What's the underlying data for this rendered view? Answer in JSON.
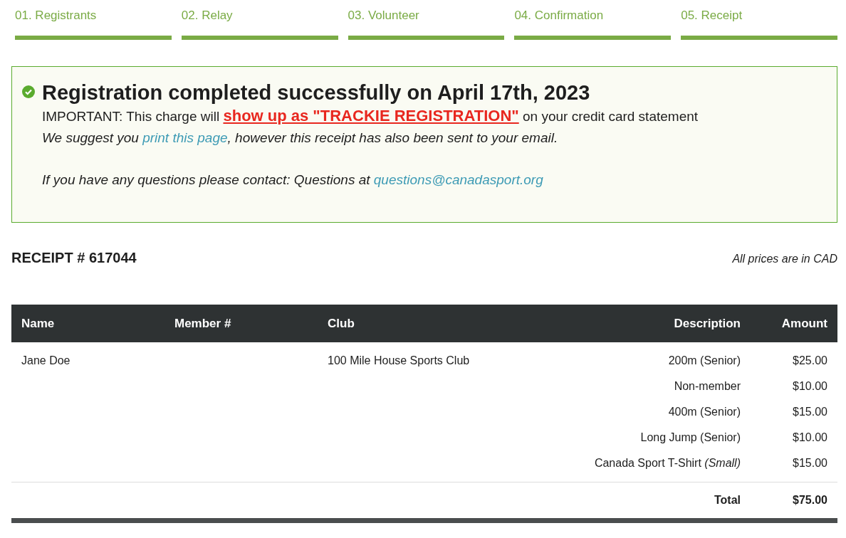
{
  "steps": [
    {
      "label": "01. Registrants",
      "completed": true
    },
    {
      "label": "02. Relay",
      "completed": true
    },
    {
      "label": "03. Volunteer",
      "completed": true
    },
    {
      "label": "04. Confirmation",
      "completed": true
    },
    {
      "label": "05. Receipt",
      "completed": true
    }
  ],
  "message": {
    "title": "Registration completed successfully on April 17th, 2023",
    "important": {
      "before": "IMPORTANT: This charge will",
      "highlight": "show up as \"TRACKIE REGISTRATION\"",
      "after": "on your credit card statement"
    },
    "suggest": {
      "before": "We suggest you",
      "link": "print this page",
      "after": ", however this receipt has also been sent to your email."
    },
    "contact": {
      "before": "If you have any questions please contact: Questions at",
      "link": "questions@canadasport.org"
    }
  },
  "receipt": {
    "title": "RECEIPT # 617044",
    "note": "All prices are in CAD"
  },
  "table": {
    "columns": [
      "Name",
      "Member #",
      "Club",
      "Description",
      "Amount"
    ],
    "rows": [
      {
        "name": "Jane Doe",
        "club": "100 Mile House Sports Club",
        "description": "200m (Senior)",
        "amount": "$25.00"
      },
      {
        "description": "Non-member",
        "amount": "$10.00"
      },
      {
        "description": "400m (Senior)",
        "amount": "$15.00"
      },
      {
        "description": "Long Jump (Senior)",
        "amount": "$10.00"
      },
      {
        "description": "Canada Sport T-Shirt *(Small)*",
        "amount": "$15.00"
      }
    ],
    "total": {
      "label": "Total",
      "amount": "$75.00"
    }
  }
}
